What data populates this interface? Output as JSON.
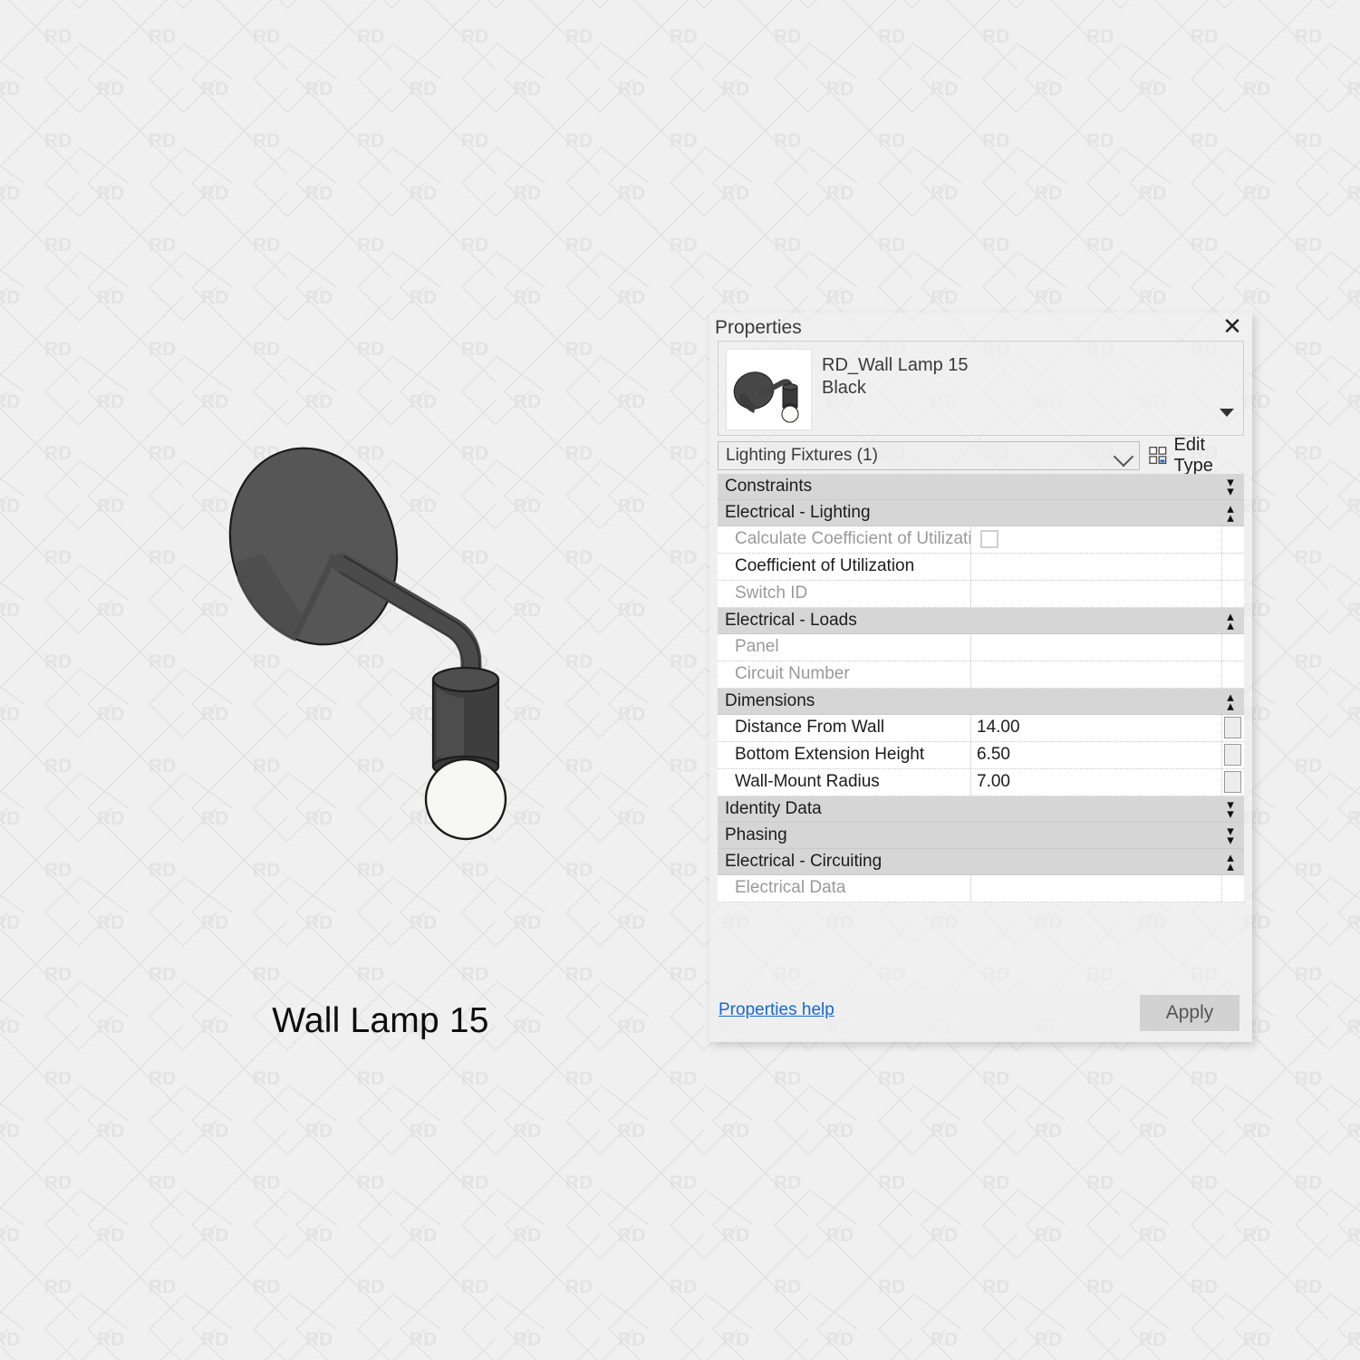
{
  "watermark": {
    "text": "RD"
  },
  "caption": "Wall Lamp 15",
  "panel": {
    "title": "Properties",
    "close_label": "✕",
    "type_name_line1": "RD_Wall Lamp 15",
    "type_name_line2": "Black",
    "category_selector": "Lighting Fixtures (1)",
    "edit_type_label": "Edit Type",
    "help_link": "Properties help",
    "apply_label": "Apply",
    "accent_link_color": "#1667d8",
    "group_header_bg": "#d6d6d6"
  },
  "groups": [
    {
      "label": "Constraints",
      "state": "collapsed",
      "chevron": "»",
      "rows": []
    },
    {
      "label": "Electrical - Lighting",
      "state": "expanded",
      "chevron": "«",
      "rows": [
        {
          "name": "Calculate Coefficient of Utilizati...",
          "value": "",
          "disabled": true,
          "control": "checkbox",
          "checked": false
        },
        {
          "name": "Coefficient of Utilization",
          "value": "",
          "disabled": false,
          "control": "text"
        },
        {
          "name": "Switch ID",
          "value": "",
          "disabled": true,
          "control": "text"
        }
      ]
    },
    {
      "label": "Electrical - Loads",
      "state": "expanded",
      "chevron": "«",
      "rows": [
        {
          "name": "Panel",
          "value": "",
          "disabled": true,
          "control": "text"
        },
        {
          "name": "Circuit Number",
          "value": "",
          "disabled": true,
          "control": "text"
        }
      ]
    },
    {
      "label": "Dimensions",
      "state": "expanded",
      "chevron": "«",
      "rows": [
        {
          "name": "Distance From Wall",
          "value": "14.00",
          "disabled": false,
          "control": "text",
          "param_button": true
        },
        {
          "name": "Bottom Extension Height",
          "value": "6.50",
          "disabled": false,
          "control": "text",
          "param_button": true
        },
        {
          "name": "Wall-Mount Radius",
          "value": "7.00",
          "disabled": false,
          "control": "text",
          "param_button": true
        }
      ]
    },
    {
      "label": "Identity Data",
      "state": "collapsed",
      "chevron": "»",
      "rows": []
    },
    {
      "label": "Phasing",
      "state": "collapsed",
      "chevron": "»",
      "rows": []
    },
    {
      "label": "Electrical - Circuiting",
      "state": "expanded",
      "chevron": "«",
      "rows": [
        {
          "name": "Electrical Data",
          "value": "",
          "disabled": true,
          "control": "text"
        }
      ]
    }
  ],
  "lamp": {
    "disc_color": "#565656",
    "disc_shadow_color": "#4a4a4a",
    "arm_color": "#4b4b4b",
    "socket_color": "#3e3e3e",
    "socket_light_color": "#555555",
    "bulb_color": "#f7f7f3",
    "outline_color": "#1b1b1b"
  }
}
